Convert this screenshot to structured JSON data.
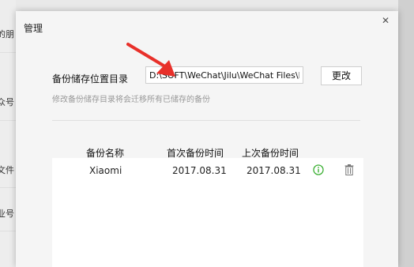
{
  "background": {
    "items": [
      "的朋",
      "公众号",
      "文件",
      "企业号"
    ]
  },
  "dialog": {
    "title": "管理",
    "close_icon": "close-icon"
  },
  "storage": {
    "label": "备份储存位置目录",
    "path_value": "D:\\SOFT\\WeChat\\Jilu\\WeChat Files\\hc",
    "change_button": "更改",
    "hint": "修改备份储存目录将会迁移所有已储存的备份"
  },
  "backup_table": {
    "headers": [
      "备份名称",
      "首次备份时间",
      "上次备份时间"
    ],
    "rows": [
      {
        "name": "Xiaomi",
        "first": "2017.08.31",
        "last": "2017.08.31"
      }
    ]
  },
  "colors": {
    "info_icon": "#3cb034",
    "arrow": "#e8302a"
  }
}
